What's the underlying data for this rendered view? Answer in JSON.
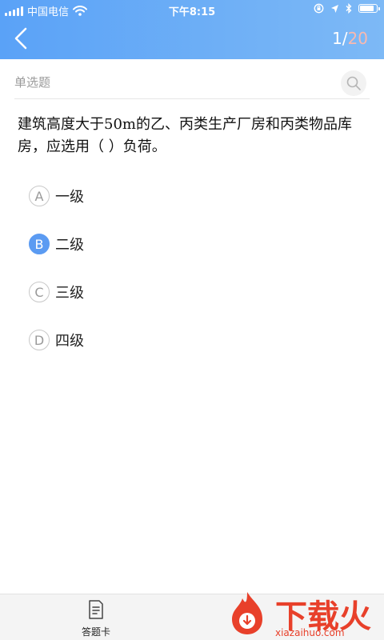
{
  "status_bar": {
    "carrier": "中国电信",
    "time": "下午8:15",
    "battery_level": 0.9
  },
  "header": {
    "back_icon": "chevron-left-icon",
    "progress_current": "1/",
    "progress_total": "20"
  },
  "question": {
    "type": "单选题",
    "text": "建筑高度大于50m的乙、丙类生产厂房和丙类物品库房，应选用（ ）负荷。",
    "options": [
      {
        "letter": "A",
        "text": "一级",
        "selected": false
      },
      {
        "letter": "B",
        "text": "二级",
        "selected": true
      },
      {
        "letter": "C",
        "text": "三级",
        "selected": false
      },
      {
        "letter": "D",
        "text": "四级",
        "selected": false
      }
    ]
  },
  "bottom_bar": {
    "answer_card_label": "答题卡",
    "answer_card_icon": "answer-sheet-icon"
  },
  "watermark": {
    "title": "下载火",
    "url": "xiazaihuo.com"
  },
  "colors": {
    "header_start": "#5aa2f7",
    "header_end": "#7db9f6",
    "selected_option": "#5b9bf2",
    "progress_total": "#f8b9b0",
    "watermark": "#e8402a"
  }
}
